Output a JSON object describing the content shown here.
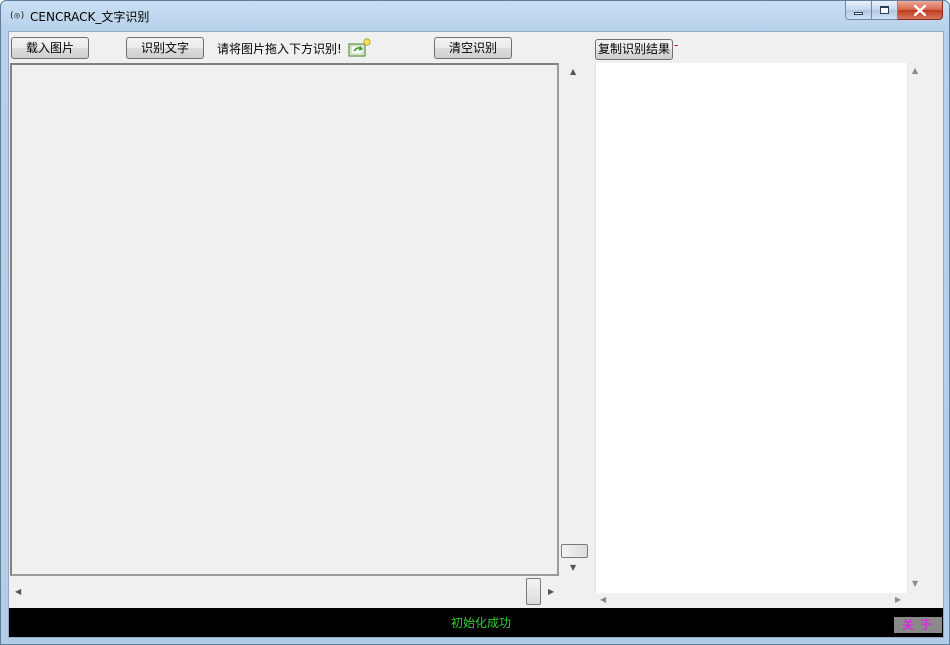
{
  "window": {
    "title": "CENCRACK_文字识别",
    "app_icon_glyph": "(◎)"
  },
  "toolbar": {
    "load_image_label": "载入图片",
    "recognize_label": "识别文字",
    "hint_text": "请将图片拖入下方识别!",
    "clear_label": "清空识别",
    "copy_result_label": "复制识别结果",
    "copy_marker": "-"
  },
  "status": {
    "message": "初始化成功",
    "about_label": "关于"
  },
  "colors": {
    "status_background": "#000000",
    "status_text": "#30d030",
    "about_text": "#ff00ff",
    "about_background": "#8a8a8a",
    "marker": "#d00000"
  },
  "icons": {
    "window_minimize": "minimize-icon",
    "window_maximize": "maximize-icon",
    "window_close": "close-icon",
    "drag_hint": "image-drop-icon"
  }
}
